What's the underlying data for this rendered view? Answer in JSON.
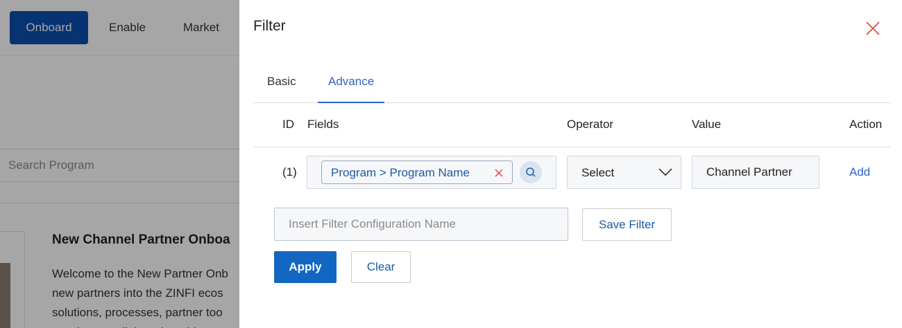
{
  "background": {
    "nav": [
      "Onboard",
      "Enable",
      "Market"
    ],
    "search_placeholder": "Search Program",
    "card": {
      "title": "New Channel Partner Onboa",
      "description_lines": [
        "Welcome to the New Partner Onb",
        "new partners into the ZINFI ecos",
        "solutions, processes, partner too",
        "accelerate collaboration, drive p"
      ]
    }
  },
  "filter": {
    "title": "Filter",
    "close_icon": "close-icon",
    "tabs": [
      {
        "label": "Basic",
        "active": false
      },
      {
        "label": "Advance",
        "active": true
      }
    ],
    "columns": {
      "id": "ID",
      "fields": "Fields",
      "operator": "Operator",
      "value": "Value",
      "action": "Action"
    },
    "rows": [
      {
        "id": "(1)",
        "field_chip": "Program > Program Name",
        "operator": "Select",
        "value": "Channel Partner",
        "action": "Add"
      }
    ],
    "config_placeholder": "Insert Filter Configuration Name",
    "save_filter": "Save Filter",
    "apply": "Apply",
    "clear": "Clear"
  },
  "colors": {
    "accent": "#2b63c8",
    "primary_button": "#1366c2",
    "close_icon": "#e04848"
  }
}
